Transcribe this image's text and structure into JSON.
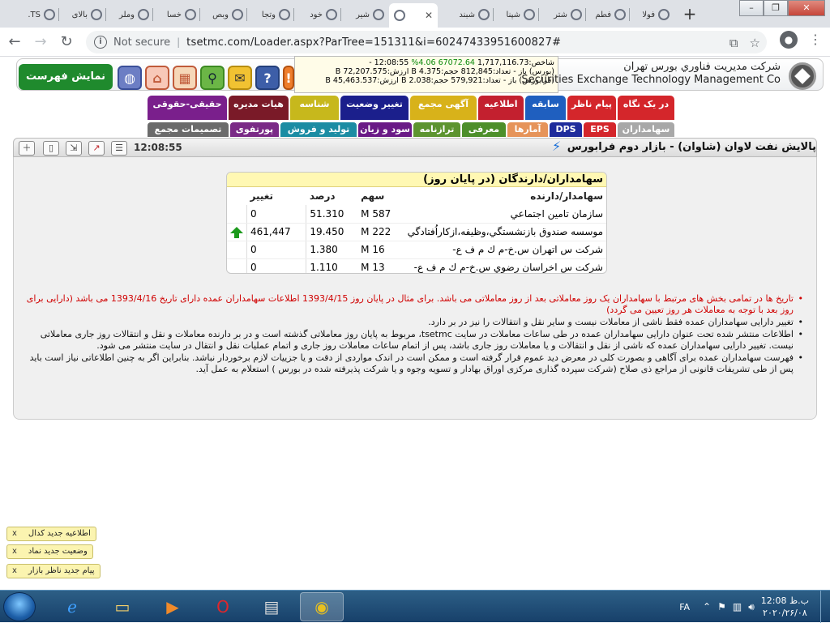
{
  "browser": {
    "tabs": [
      {
        "title": "فولا"
      },
      {
        "title": "فطم"
      },
      {
        "title": "شتر"
      },
      {
        "title": "شپنا"
      },
      {
        "title": "شبند"
      },
      {
        "title": "",
        "active": true
      },
      {
        "title": "شیر"
      },
      {
        "title": "خود"
      },
      {
        "title": "وتجا"
      },
      {
        "title": "وبص"
      },
      {
        "title": "خسا"
      },
      {
        "title": "وملر"
      },
      {
        "title": "بالای"
      },
      {
        "title": "TS."
      }
    ],
    "new_tab": "+",
    "url_security": "Not secure",
    "url": "tsetmc.com/Loader.aspx?ParTree=151311&i=60247433951600827#"
  },
  "header": {
    "show_list_label": "نمایش فهرست",
    "company_fa": "شركت مديريت فناوري بورس تهران",
    "company_en": "Securities Exchange Technology Management Co",
    "icons": [
      "globe-icon",
      "home-icon",
      "table-icon",
      "search-icon",
      "chat-icon",
      "help-icon"
    ],
    "ticker": {
      "line1_label": "شاخص:",
      "line1_value": "1,717,116.73",
      "line1_change": "67072.64",
      "line1_pct": "4.06%",
      "line1_time": "12:08:55 -",
      "line2": "(بورس) باز - تعداد:812,845 حجم:B 4.375 ارزش:B 72,207.575",
      "line3": "(فرابورس) باز - تعداد:579,921 حجم:B 2.038 ارزش:B 45,463.537"
    }
  },
  "nav": {
    "row1": [
      {
        "label": "در یک نگاه",
        "color": "#d4262b"
      },
      {
        "label": "پیام ناظر",
        "color": "#d4262b"
      },
      {
        "label": "سابقه",
        "color": "#1f5fbf"
      },
      {
        "label": "اطلاعیه",
        "color": "#c3202f"
      },
      {
        "label": "آگهی مجمع",
        "color": "#d8b21a"
      },
      {
        "label": "تغییر وضعیت",
        "color": "#1b1f8c"
      },
      {
        "label": "شناسه",
        "color": "#c7b81c"
      },
      {
        "label": "هیات مدیره",
        "color": "#7a1a28"
      },
      {
        "label": "حقیقی-حقوقی",
        "color": "#7a1f8c"
      }
    ],
    "row2": [
      {
        "label": "سهامداران",
        "color": "#a8a8a8"
      },
      {
        "label": "EPS",
        "color": "#d4262b"
      },
      {
        "label": "DPS",
        "color": "#1f2c9c"
      },
      {
        "label": "آمارها",
        "color": "#e6945a"
      },
      {
        "label": "معرفی",
        "color": "#4d8f2a"
      },
      {
        "label": "ترازنامه",
        "color": "#5d9430"
      },
      {
        "label": "سود و زیان",
        "color": "#6a1a86"
      },
      {
        "label": "تولید و فروش",
        "color": "#1b8ca3"
      },
      {
        "label": "پورتفوی",
        "color": "#7a2a86"
      },
      {
        "label": "تصمیمات مجمع",
        "color": "#6b6b6b"
      }
    ]
  },
  "titlebar": {
    "symbol_title": "پالايش نفت لاوان (شاوان) - بازار دوم فرابورس",
    "time": "12:08:55"
  },
  "holders": {
    "caption": "سهامداران/دارندگان (در پایان روز)",
    "columns": {
      "name": "سهامدار/دارنده",
      "shares": "سهم",
      "percent": "درصد",
      "change": "تغییر"
    },
    "rows": [
      {
        "name": "سازمان تامين اجتماعي",
        "shares": "587 M",
        "percent": "51.310",
        "change": "0",
        "arrow": false
      },
      {
        "name": "موسسه صندوق بازنشستگي،وظيفه،ازكاراُفتادگي وپ",
        "shares": "222 M",
        "percent": "19.450",
        "change": "461,447",
        "arrow": true
      },
      {
        "name": "شركت س اتهران س.خ-م ك م ف ع-",
        "shares": "16 M",
        "percent": "1.380",
        "change": "0",
        "arrow": false
      },
      {
        "name": "شركت س اخراسان رضوي س.خ-م ك م ف ع-",
        "shares": "13 M",
        "percent": "1.110",
        "change": "0",
        "arrow": false
      }
    ]
  },
  "notes": [
    {
      "text": "تاریخ ها در تمامی بخش های مرتبط با سهامداران یک روز معاملاتی بعد از روز معاملاتی می باشد. برای مثال در پایان روز 1393/4/15 اطلاعات سهامداران عمده دارای تاریخ 1393/4/16 می باشد (دارایی برای روز بعد با توجه به معاملات هر روز تعیین می گردد)",
      "red": true
    },
    {
      "text": "تغییر دارایی سهامداران عمده فقط ناشی از معاملات نیست و سایر نقل و انتقالات را نیز در بر دارد.",
      "red": false
    },
    {
      "text": "اطلاعات منتشر شده تحت عنوان دارایی سهامداران عمده در طی ساعات معاملات در سایت tsetmc، مربوط به پایان روز معاملاتی گذشته است و در بر دارنده معاملات و نقل و انتقالات روز جاری معاملاتی نیست. تغییر دارایی سهامداران عمده که ناشی از نقل و انتقالات و یا معاملات روز جاری باشد، پس از اتمام ساعات معاملات روز جاری و اتمام عملیات نقل و انتقال در سایت منتشر می شود.",
      "red": false
    },
    {
      "text": "فهرست سهامداران عمده برای آگاهی و بصورت کلی در معرض دید عموم قرار گرفته است و ممکن است در اندک مواردی از دقت و یا جزییات لازم برخوردار نباشد. بنابراین اگر به چنین اطلاعاتی نیاز است باید پس از طی تشریفات قانونی از مراجع ذی صلاح (شرکت سپرده گذاری مرکزی اوراق بهادار و تسویه وجوه و یا شرکت پذیرفته شده در بورس ) استعلام به عمل آید.",
      "red": false
    }
  ],
  "notifications": [
    {
      "label": "اطلاعیه جدید کدال",
      "close": "x"
    },
    {
      "label": "وضعیت جدید نماد",
      "close": "x"
    },
    {
      "label": "پیام جدید ناظر بازار",
      "close": "x"
    }
  ],
  "taskbar": {
    "lang": "FA",
    "time": "12:08 ب.ظ",
    "date": "۲۰۲۰/۲۶/۰۸"
  }
}
